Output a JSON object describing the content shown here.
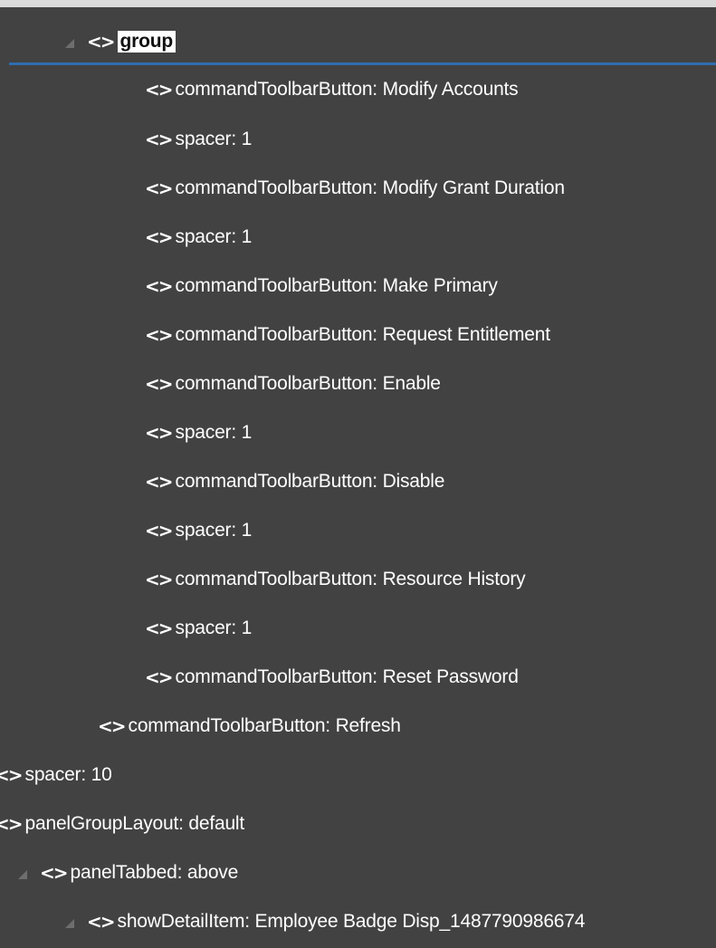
{
  "tree": {
    "tag_glyph": "<>",
    "nodes": [
      {
        "label": "group",
        "expanded": true,
        "selected": true
      },
      {
        "label": "commandToolbarButton: Modify Accounts"
      },
      {
        "label": "spacer: 1"
      },
      {
        "label": "commandToolbarButton: Modify Grant Duration"
      },
      {
        "label": "spacer: 1"
      },
      {
        "label": "commandToolbarButton: Make Primary"
      },
      {
        "label": "commandToolbarButton: Request Entitlement"
      },
      {
        "label": "commandToolbarButton: Enable"
      },
      {
        "label": "spacer: 1"
      },
      {
        "label": "commandToolbarButton: Disable"
      },
      {
        "label": "spacer: 1"
      },
      {
        "label": "commandToolbarButton: Resource History"
      },
      {
        "label": "spacer: 1"
      },
      {
        "label": "commandToolbarButton: Reset Password"
      },
      {
        "label": "commandToolbarButton: Refresh"
      },
      {
        "label": "spacer: 10"
      },
      {
        "label": "panelGroupLayout: default"
      },
      {
        "label": "panelTabbed: above",
        "expanded": true
      },
      {
        "label": "showDetailItem: Employee Badge Disp_1487790986674",
        "expanded": true
      }
    ]
  },
  "colors": {
    "background": "#424242",
    "text": "#ffffff",
    "selection_bar": "#2f6db0"
  }
}
